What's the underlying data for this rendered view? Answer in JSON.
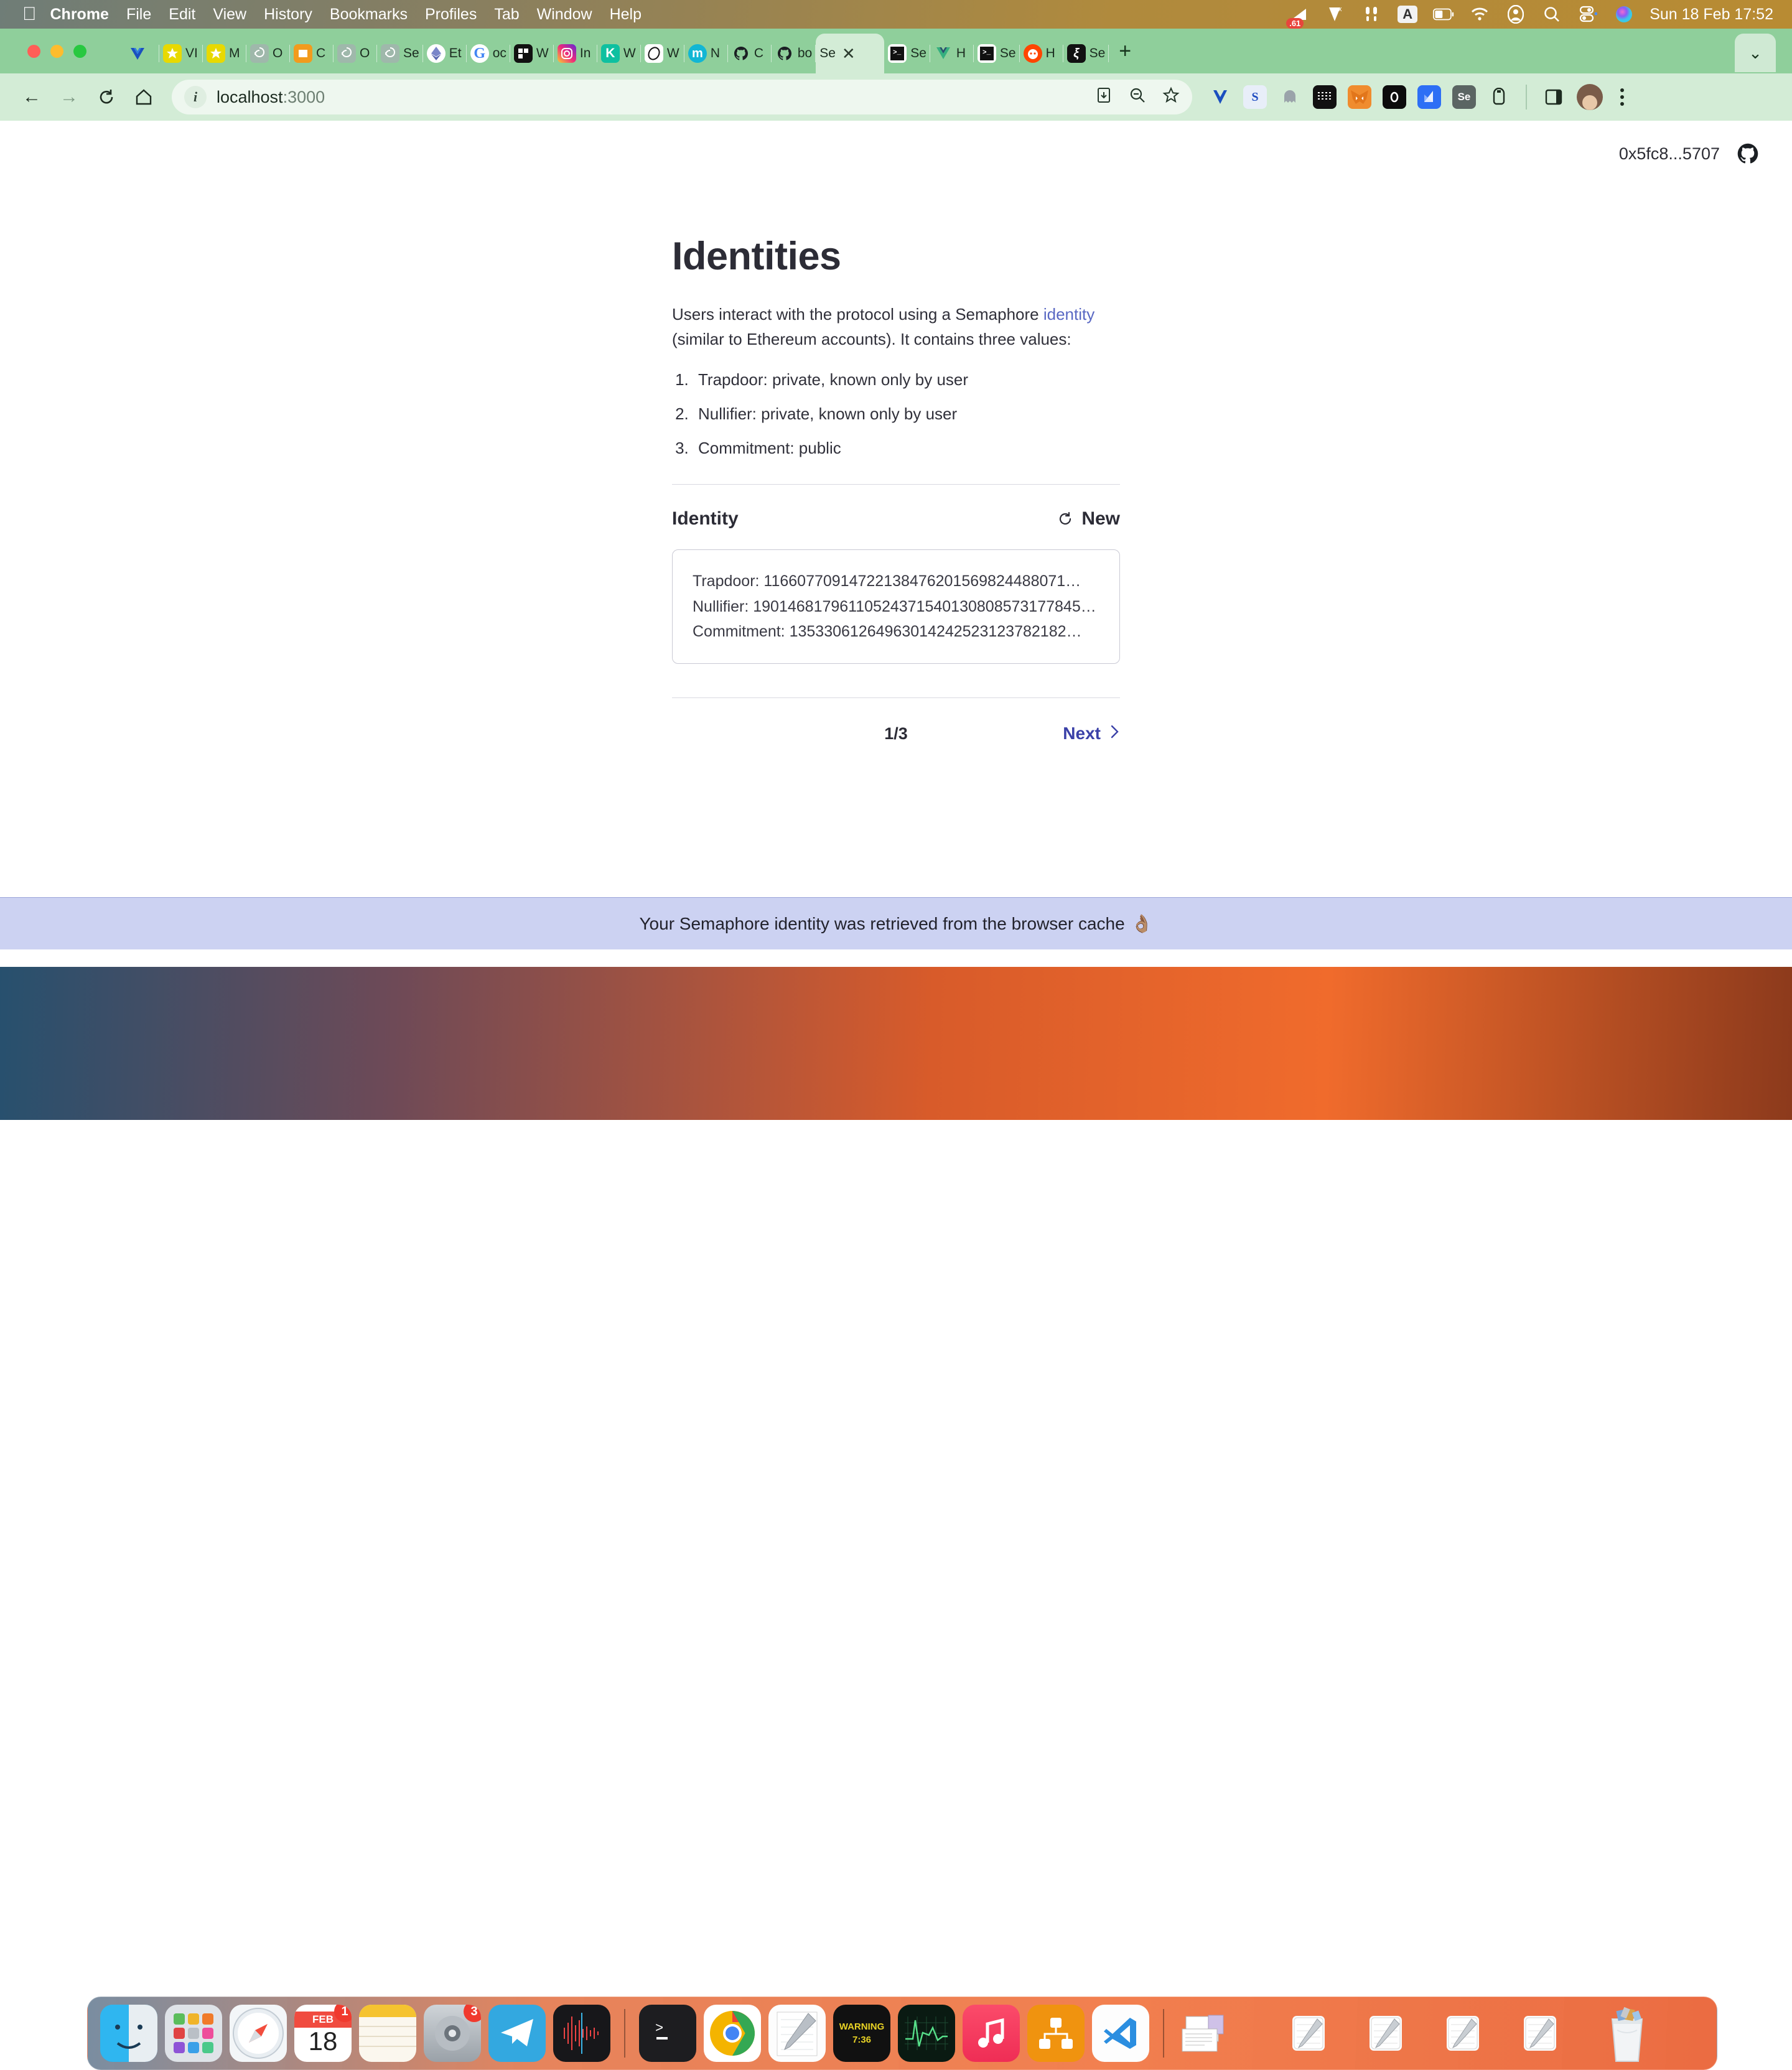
{
  "menubar": {
    "apple_icon": "apple-logo-icon",
    "items": [
      {
        "label": "Chrome",
        "bold": true
      },
      {
        "label": "File",
        "bold": false
      },
      {
        "label": "Edit",
        "bold": false
      },
      {
        "label": "View",
        "bold": false
      },
      {
        "label": "History",
        "bold": false
      },
      {
        "label": "Bookmarks",
        "bold": false
      },
      {
        "label": "Profiles",
        "bold": false
      },
      {
        "label": "Tab",
        "bold": false
      },
      {
        "label": "Window",
        "bold": false
      },
      {
        "label": "Help",
        "bold": false
      }
    ],
    "status": {
      "speedtest_badge": ".61",
      "input_source": "A",
      "clock": "Sun 18 Feb  17:52"
    }
  },
  "browser": {
    "tabs": [
      {
        "label": "",
        "favicon": "vue-icon",
        "active": false
      },
      {
        "label": "VI",
        "favicon": "star-yellow-icon",
        "active": false
      },
      {
        "label": "M",
        "favicon": "star-yellow-icon",
        "active": false
      },
      {
        "label": "O",
        "favicon": "openai-icon",
        "active": false
      },
      {
        "label": "C",
        "favicon": "orange-square-icon",
        "active": false
      },
      {
        "label": "O",
        "favicon": "openai-icon",
        "active": false
      },
      {
        "label": "Se",
        "favicon": "openai-icon",
        "active": false
      },
      {
        "label": "Et",
        "favicon": "ethereum-icon",
        "active": false
      },
      {
        "label": "oc",
        "favicon": "google-icon",
        "active": false
      },
      {
        "label": "W",
        "favicon": "checker-icon",
        "active": false
      },
      {
        "label": "In",
        "favicon": "instagram-icon",
        "active": false
      },
      {
        "label": "W",
        "favicon": "teal-k-icon",
        "active": false
      },
      {
        "label": "W",
        "favicon": "clip-icon",
        "active": false
      },
      {
        "label": "N",
        "favicon": "medium-m-icon",
        "active": false
      },
      {
        "label": "C",
        "favicon": "github-icon",
        "active": false
      },
      {
        "label": "bo",
        "favicon": "github-icon",
        "active": false
      },
      {
        "label": "Se",
        "favicon": "semaphore-icon",
        "active": true
      },
      {
        "label": "Se",
        "favicon": "terminal-icon",
        "active": false
      },
      {
        "label": "H",
        "favicon": "vue-icon",
        "active": false
      },
      {
        "label": "Se",
        "favicon": "terminal-icon",
        "active": false
      },
      {
        "label": "H",
        "favicon": "reddit-icon",
        "active": false
      },
      {
        "label": "Se",
        "favicon": "sandbox-icon",
        "active": false
      }
    ],
    "tab_close_icon": "close-icon",
    "new_tab_icon": "plus-icon",
    "tab_list_icon": "chevron-down-icon",
    "nav": {
      "back_icon": "back-arrow-icon",
      "forward_icon": "forward-arrow-icon",
      "reload_icon": "reload-icon",
      "home_icon": "home-icon"
    },
    "omnibox": {
      "site_info_icon": "info-circle-icon",
      "url_host": "localhost",
      "url_port": ":3000",
      "install_icon": "install-app-icon",
      "zoom_icon": "zoom-out-icon",
      "bookmark_icon": "star-outline-icon"
    },
    "extensions": [
      "vue-devtools-icon",
      "semaphore-ext-icon",
      "ghost-icon",
      "zebra-icon",
      "metamask-icon",
      "obsidian-icon",
      "blue-arrow-icon",
      "selenium-icon",
      "pocket-icon"
    ],
    "sidepanel_icon": "side-panel-icon",
    "profile_icon": "profile-avatar",
    "menu_icon": "kebab-menu-icon"
  },
  "page": {
    "wallet_address": "0x5fc8...5707",
    "github_icon": "github-icon",
    "title": "Identities",
    "intro_part1": "Users interact with the protocol using a Semaphore ",
    "intro_link": "identity",
    "intro_part2": " (similar to Ethereum accounts). It contains three values:",
    "values": [
      "Trapdoor: private, known only by user",
      "Nullifier: private, known only by user",
      "Commitment: public"
    ],
    "identity_heading": "Identity",
    "new_button_label": "New",
    "new_button_icon": "refresh-icon",
    "identity_card": {
      "trapdoor": "Trapdoor: 11660770914722138476201569824488071…",
      "nullifier": "Nullifier: 19014681796110524371540130808573177845…",
      "commitment": "Commitment: 13533061264963014242523123782182…"
    },
    "page_indicator": "1/3",
    "next_label": "Next",
    "next_icon": "chevron-right-icon",
    "toast_message": "Your Semaphore identity was retrieved from the browser cache",
    "toast_emoji": "👌🏽",
    "accent_link_color": "#5968c3",
    "next_color": "#3b41a8",
    "toast_bg": "#ccd2f2"
  },
  "dock": {
    "items": [
      {
        "name": "finder-icon",
        "badge": ""
      },
      {
        "name": "launchpad-icon",
        "badge": ""
      },
      {
        "name": "safari-icon",
        "badge": ""
      },
      {
        "name": "calendar-icon",
        "badge": "1",
        "month": "FEB",
        "day": "18"
      },
      {
        "name": "notes-icon",
        "badge": ""
      },
      {
        "name": "system-settings-icon",
        "badge": "3"
      },
      {
        "name": "telegram-icon",
        "badge": ""
      },
      {
        "name": "audio-wave-icon",
        "badge": ""
      },
      {
        "name": "iterm-icon",
        "badge": ""
      },
      {
        "name": "chrome-icon",
        "badge": ""
      },
      {
        "name": "textedit-icon",
        "badge": ""
      },
      {
        "name": "watch-warning-icon",
        "badge": "",
        "text": "WARNING 7:36"
      },
      {
        "name": "activity-monitor-icon",
        "badge": ""
      },
      {
        "name": "music-icon",
        "badge": ""
      },
      {
        "name": "xmind-icon",
        "badge": ""
      },
      {
        "name": "vscode-icon",
        "badge": ""
      }
    ],
    "recents": [
      "stack-icon",
      "doc-icon",
      "doc-icon",
      "doc-icon",
      "doc-icon"
    ],
    "trash_icon": "trash-full-icon"
  }
}
